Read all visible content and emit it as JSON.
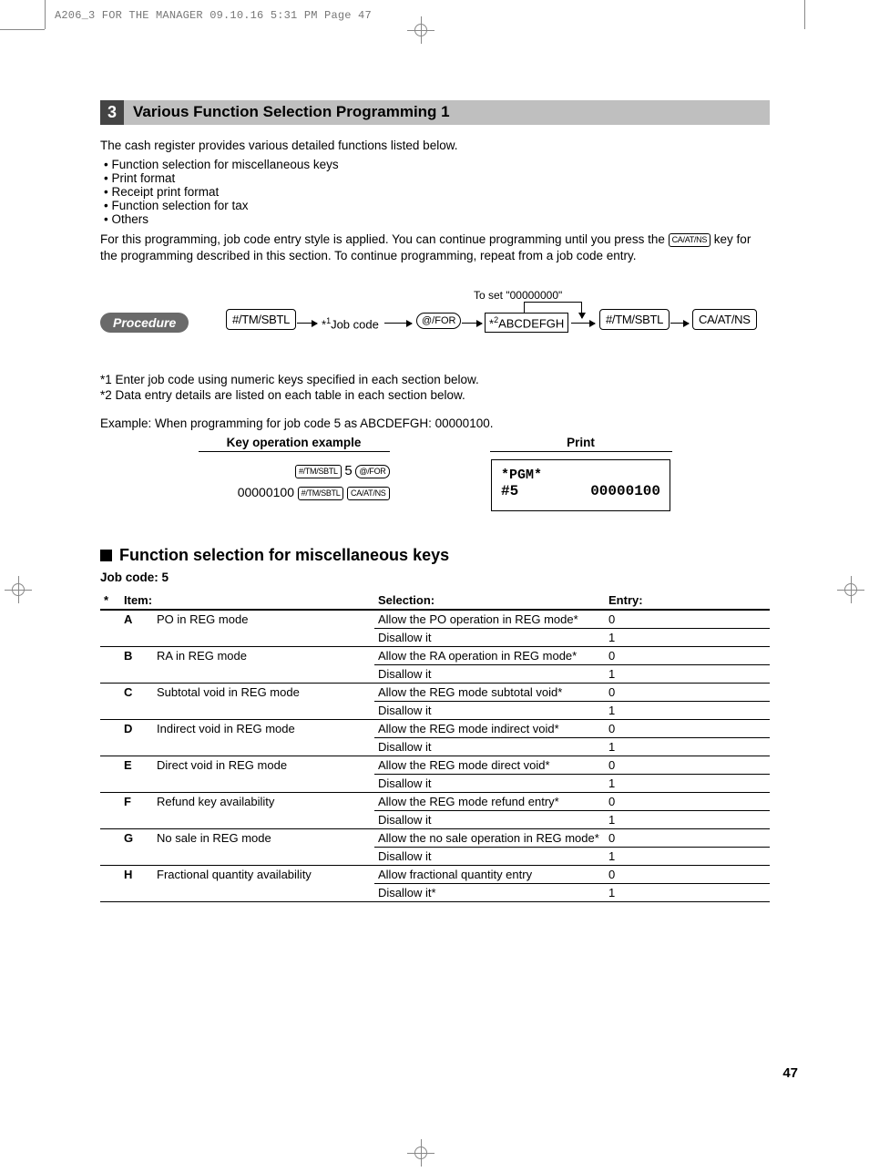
{
  "header_line": "A206_3 FOR THE MANAGER  09.10.16 5:31 PM  Page 47",
  "page_number": "47",
  "section_number": "3",
  "section_title": "Various Function Selection Programming 1",
  "intro_para": "The cash register provides various detailed functions listed below.",
  "bullets": [
    "Function selection for miscellaneous keys",
    "Print format",
    "Receipt print format",
    "Function selection for tax",
    "Others"
  ],
  "para2_a": "For this programming, job code entry style is applied.  You can continue programming until you press the ",
  "para2_key": "CA/AT/NS",
  "para2_b": " key for the programming described in this section.  To continue programming, repeat from a job code entry.",
  "procedure_label": "Procedure",
  "to_set_label": "To set \"00000000\"",
  "proc_nodes": {
    "n1": "#/TM/SBTL",
    "n2_pre": "*",
    "n2_sup": "1",
    "n2_post": "Job code",
    "n3": "@/FOR",
    "n4_pre": "*",
    "n4_sup": "2",
    "n4_post": "ABCDEFGH",
    "n5": "#/TM/SBTL",
    "n6": "CA/AT/NS"
  },
  "note1": "*1  Enter job code using numeric keys specified in each section below.",
  "note2": "*2  Data entry details are listed on each table in each section below.",
  "example_line": "Example:  When programming for job code 5 as ABCDEFGH: 00000100.",
  "example_key_head": "Key operation example",
  "example_print_head": "Print",
  "key_ops": {
    "r1_k1": "#/TM/SBTL",
    "r1_num": "5",
    "r1_k2": "@/FOR",
    "r2_num": "00000100",
    "r2_k1": "#/TM/SBTL",
    "r2_k2": "CA/AT/NS"
  },
  "print_box": {
    "line1": "*PGM*",
    "line2_left": "#5",
    "line2_right": "00000100"
  },
  "sub_title": "Function selection for miscellaneous keys",
  "job_code_line": "Job code:  5",
  "table_head_star": "*",
  "table_head_item": "Item:",
  "table_head_sel": "Selection:",
  "table_head_entry": "Entry:",
  "rows": [
    {
      "l": "A",
      "item": "PO in REG mode",
      "s1": "Allow the PO operation in REG mode*",
      "e1": "0",
      "s2": "Disallow it",
      "e2": "1"
    },
    {
      "l": "B",
      "item": "RA in REG mode",
      "s1": "Allow the RA operation in REG mode*",
      "e1": "0",
      "s2": "Disallow it",
      "e2": "1"
    },
    {
      "l": "C",
      "item": "Subtotal void in REG mode",
      "s1": "Allow the REG mode subtotal void*",
      "e1": "0",
      "s2": "Disallow it",
      "e2": "1"
    },
    {
      "l": "D",
      "item": "Indirect void in REG mode",
      "s1": "Allow the REG mode indirect void*",
      "e1": "0",
      "s2": "Disallow it",
      "e2": "1"
    },
    {
      "l": "E",
      "item": "Direct void in REG mode",
      "s1": "Allow the REG mode direct void*",
      "e1": "0",
      "s2": "Disallow it",
      "e2": "1"
    },
    {
      "l": "F",
      "item": "Refund key availability",
      "s1": "Allow the REG mode refund entry*",
      "e1": "0",
      "s2": "Disallow it",
      "e2": "1"
    },
    {
      "l": "G",
      "item": "No sale in REG mode",
      "s1": "Allow the no sale operation in REG mode*",
      "e1": "0",
      "s2": "Disallow it",
      "e2": "1"
    },
    {
      "l": "H",
      "item": "Fractional quantity availability",
      "s1": "Allow fractional quantity entry",
      "e1": "0",
      "s2": "Disallow it*",
      "e2": "1"
    }
  ]
}
